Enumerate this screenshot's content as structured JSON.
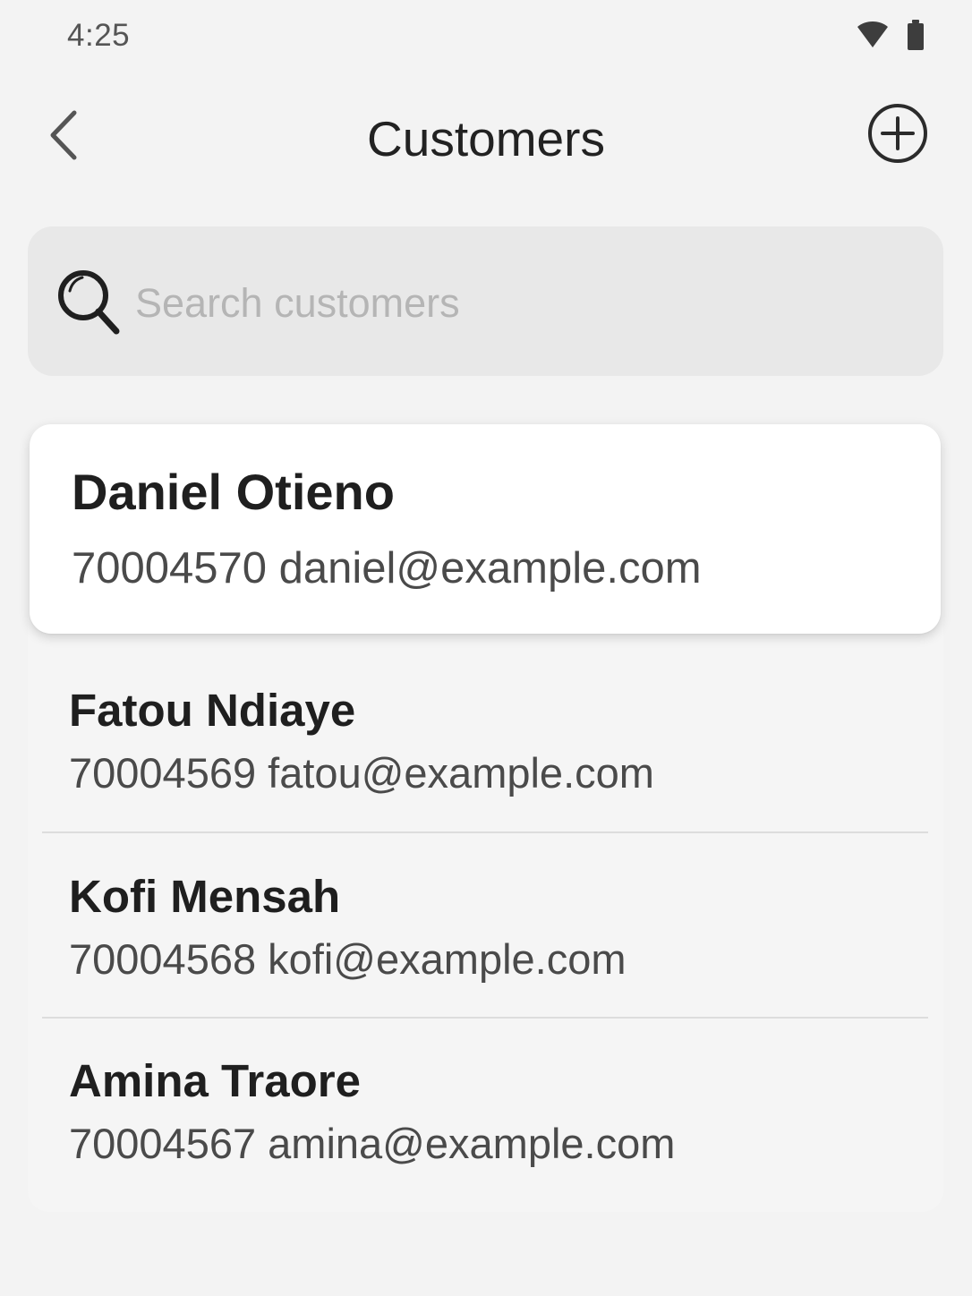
{
  "status_bar": {
    "time": "4:25",
    "icons": [
      "wifi-icon",
      "battery-icon"
    ]
  },
  "header": {
    "title": "Customers",
    "left_action_icon": "chevron-left-icon",
    "right_action_icon": "plus-circle-icon"
  },
  "search": {
    "placeholder": "Search customers",
    "value": "",
    "icon": "search-icon"
  },
  "customers": [
    {
      "name": "Daniel Otieno",
      "meta": "70004570 daniel@example.com",
      "selected": true
    },
    {
      "name": "Fatou Ndiaye",
      "meta": "70004569 fatou@example.com",
      "selected": false
    },
    {
      "name": "Kofi Mensah",
      "meta": "70004568 kofi@example.com",
      "selected": false
    },
    {
      "name": "Amina Traore",
      "meta": "70004567 amina@example.com",
      "selected": false
    }
  ],
  "colors": {
    "background": "#f3f3f3",
    "search_field": "#e8e8e8",
    "selected_card": "#ffffff",
    "text_primary": "#1f1f1f",
    "text_secondary": "#4a4a4a",
    "placeholder": "#b5b5b5"
  }
}
